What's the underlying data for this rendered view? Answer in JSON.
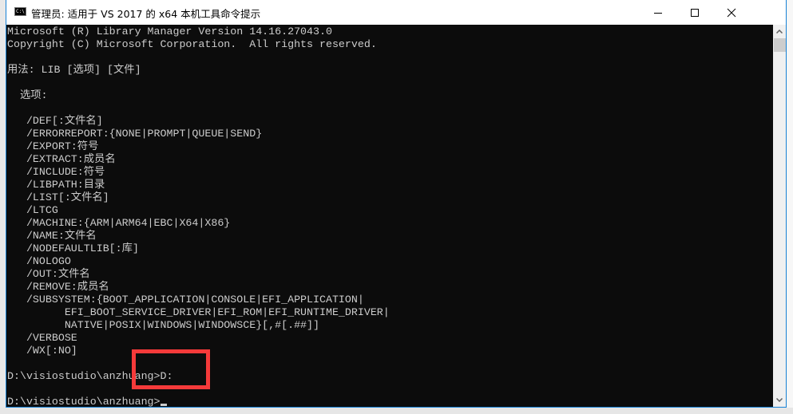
{
  "window": {
    "title": "管理员: 适用于 VS 2017 的 x64 本机工具命令提示",
    "icon": "cmd-icon",
    "controls": [
      "minimize",
      "maximize",
      "close"
    ]
  },
  "console": {
    "lines": [
      "Microsoft (R) Library Manager Version 14.16.27043.0",
      "Copyright (C) Microsoft Corporation.  All rights reserved.",
      "",
      "用法: LIB [选项] [文件]",
      "",
      "  选项:",
      "",
      "   /DEF[:文件名]",
      "   /ERRORREPORT:{NONE|PROMPT|QUEUE|SEND}",
      "   /EXPORT:符号",
      "   /EXTRACT:成员名",
      "   /INCLUDE:符号",
      "   /LIBPATH:目录",
      "   /LIST[:文件名]",
      "   /LTCG",
      "   /MACHINE:{ARM|ARM64|EBC|X64|X86}",
      "   /NAME:文件名",
      "   /NODEFAULTLIB[:库]",
      "   /NOLOGO",
      "   /OUT:文件名",
      "   /REMOVE:成员名",
      "   /SUBSYSTEM:{BOOT_APPLICATION|CONSOLE|EFI_APPLICATION|",
      "         EFI_BOOT_SERVICE_DRIVER|EFI_ROM|EFI_RUNTIME_DRIVER|",
      "         NATIVE|POSIX|WINDOWS|WINDOWSCE}[,#[.##]]",
      "   /VERBOSE",
      "   /WX[:NO]",
      "",
      "D:\\visiostudio\\anzhuang>D:",
      "",
      "D:\\visiostudio\\anzhuang>"
    ]
  },
  "annotation": {
    "color": "#f53a3a"
  }
}
